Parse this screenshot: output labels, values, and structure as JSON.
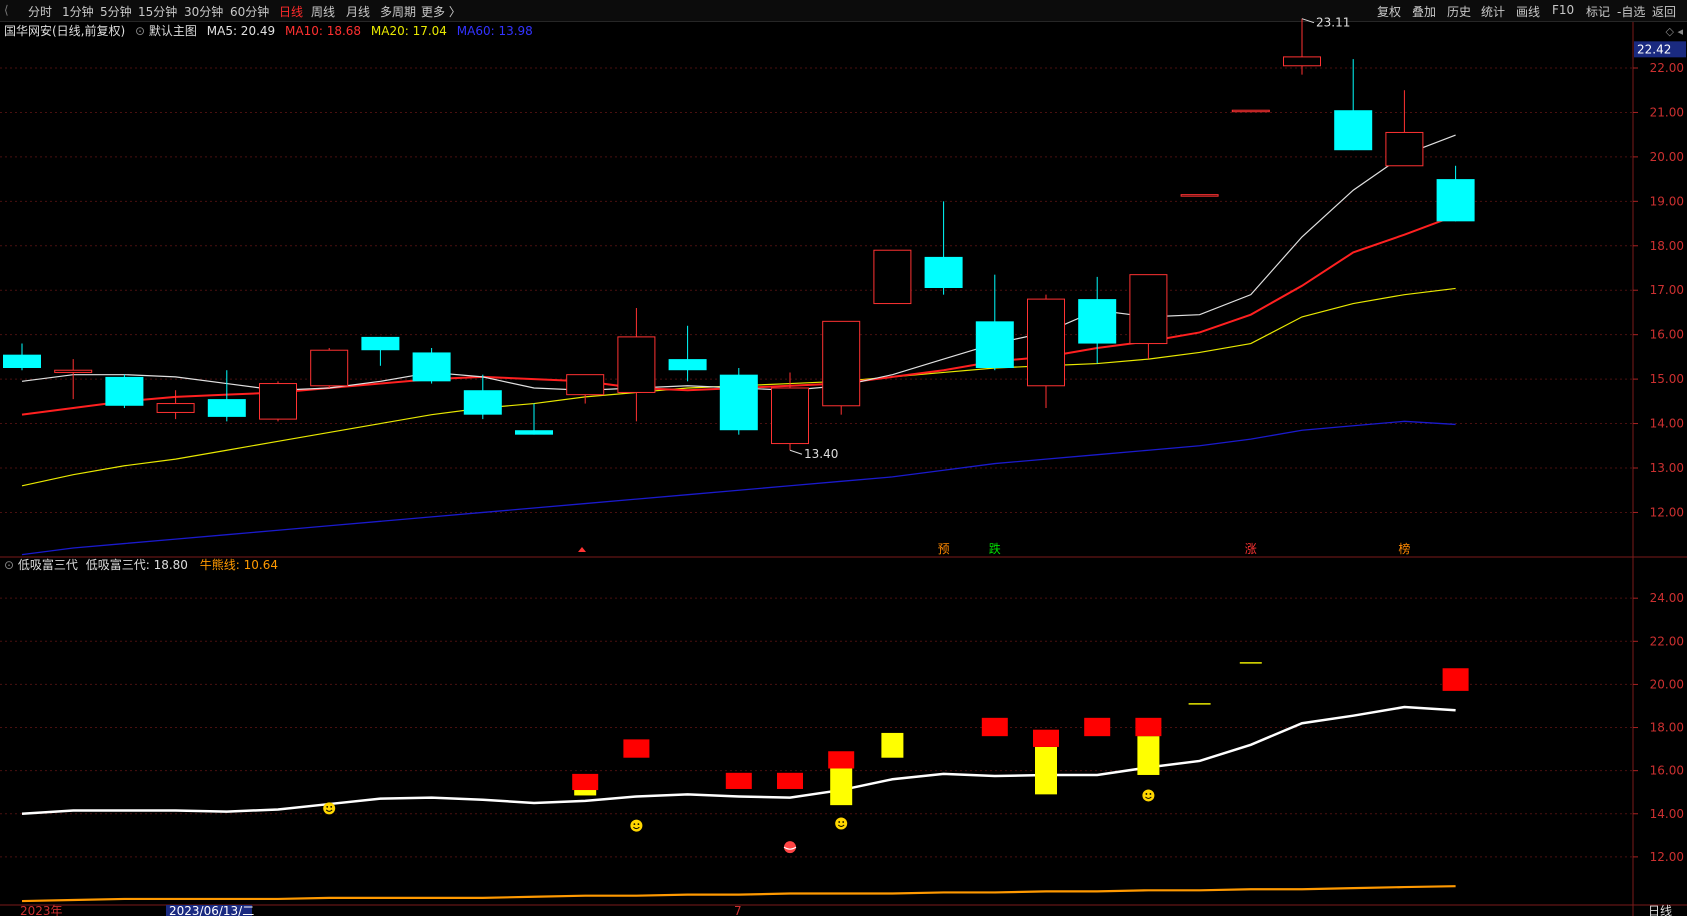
{
  "toolbar": {
    "periods": [
      {
        "label": "分时",
        "active": false
      },
      {
        "label": "1分钟",
        "active": false
      },
      {
        "label": "5分钟",
        "active": false
      },
      {
        "label": "15分钟",
        "active": false
      },
      {
        "label": "30分钟",
        "active": false
      },
      {
        "label": "60分钟",
        "active": false
      },
      {
        "label": "日线",
        "active": true
      },
      {
        "label": "周线",
        "active": false
      },
      {
        "label": "月线",
        "active": false
      },
      {
        "label": "多周期",
        "active": false
      },
      {
        "label": "更多 〉",
        "active": false
      }
    ],
    "right_items": [
      "复权",
      "叠加",
      "历史",
      "统计",
      "画线",
      "F10",
      "标记",
      "-自选",
      "返回"
    ]
  },
  "main_legend": {
    "stock": "国华网安(日线,前复权)",
    "template": "默认主图",
    "ma5": "MA5: 20.49",
    "ma10": "MA10: 18.68",
    "ma20": "MA20: 17.04",
    "ma60": "MA60: 13.98"
  },
  "sub_legend": {
    "name": "低吸富三代",
    "value1": "低吸富三代: 18.80",
    "value2": "牛熊线: 10.64"
  },
  "colors": {
    "up": "#ff3232",
    "down": "#00ffff",
    "ma5": "#e0e0e0",
    "ma10": "#ff2020",
    "ma20": "#e8e800",
    "ma60": "#1a1acc",
    "bullbear": "#ff9900",
    "sub_white": "#ffffff"
  },
  "chart_data": {
    "main": {
      "type": "candlestick",
      "ylim": [
        11.2,
        22.9
      ],
      "price_label": "22.42",
      "ticks": [
        12.0,
        13.0,
        14.0,
        15.0,
        16.0,
        17.0,
        18.0,
        19.0,
        20.0,
        21.0,
        22.0
      ],
      "candles": [
        {
          "o": 15.55,
          "c": 15.25,
          "h": 15.8,
          "l": 15.2
        },
        {
          "o": 15.15,
          "c": 15.2,
          "h": 15.45,
          "l": 14.55
        },
        {
          "o": 15.05,
          "c": 14.4,
          "h": 15.1,
          "l": 14.35
        },
        {
          "o": 14.25,
          "c": 14.45,
          "h": 14.75,
          "l": 14.1
        },
        {
          "o": 14.55,
          "c": 14.15,
          "h": 15.2,
          "l": 14.05
        },
        {
          "o": 14.1,
          "c": 14.9,
          "h": 14.95,
          "l": 14.05
        },
        {
          "o": 14.85,
          "c": 15.65,
          "h": 15.7,
          "l": 14.8
        },
        {
          "o": 15.95,
          "c": 15.65,
          "h": 15.95,
          "l": 15.3
        },
        {
          "o": 15.6,
          "c": 14.95,
          "h": 15.7,
          "l": 14.9
        },
        {
          "o": 14.75,
          "c": 14.2,
          "h": 15.1,
          "l": 14.1
        },
        {
          "o": 13.85,
          "c": 13.75,
          "h": 14.45,
          "l": 13.75
        },
        {
          "o": 14.65,
          "c": 15.1,
          "h": 15.1,
          "l": 14.45
        },
        {
          "o": 14.7,
          "c": 15.95,
          "h": 16.6,
          "l": 14.05
        },
        {
          "o": 15.45,
          "c": 15.2,
          "h": 16.2,
          "l": 14.95
        },
        {
          "o": 15.1,
          "c": 13.85,
          "h": 15.25,
          "l": 13.75
        },
        {
          "o": 13.55,
          "c": 14.8,
          "h": 15.15,
          "l": 13.4
        },
        {
          "o": 14.4,
          "c": 16.3,
          "h": 16.3,
          "l": 14.2
        },
        {
          "o": 16.7,
          "c": 17.9,
          "h": 17.9,
          "l": 16.7
        },
        {
          "o": 17.75,
          "c": 17.05,
          "h": 19.0,
          "l": 16.9
        },
        {
          "o": 16.3,
          "c": 15.25,
          "h": 17.35,
          "l": 15.2
        },
        {
          "o": 14.85,
          "c": 16.8,
          "h": 16.9,
          "l": 14.35
        },
        {
          "o": 16.8,
          "c": 15.8,
          "h": 17.3,
          "l": 15.35
        },
        {
          "o": 15.8,
          "c": 17.35,
          "h": 17.35,
          "l": 15.45
        },
        {
          "o": 19.15,
          "c": 19.15,
          "h": 19.15,
          "l": 19.15
        },
        {
          "o": 21.05,
          "c": 21.05,
          "h": 21.05,
          "l": 21.05
        },
        {
          "o": 22.05,
          "c": 22.25,
          "h": 23.11,
          "l": 21.85
        },
        {
          "o": 21.05,
          "c": 20.15,
          "h": 22.2,
          "l": 20.15
        },
        {
          "o": 19.8,
          "c": 20.55,
          "h": 21.5,
          "l": 19.8
        },
        {
          "o": 19.5,
          "c": 18.55,
          "h": 19.8,
          "l": 18.55
        }
      ],
      "ma5": [
        14.95,
        15.1,
        15.1,
        15.05,
        14.9,
        14.75,
        14.8,
        14.95,
        15.15,
        15.05,
        14.8,
        14.75,
        14.8,
        14.85,
        14.8,
        14.75,
        14.85,
        15.1,
        15.45,
        15.8,
        16.05,
        16.55,
        16.4,
        16.45,
        16.9,
        18.2,
        19.25,
        20.05,
        20.49
      ],
      "ma10": [
        14.2,
        14.35,
        14.5,
        14.6,
        14.65,
        14.7,
        14.8,
        14.9,
        15.0,
        15.05,
        15.0,
        14.95,
        14.8,
        14.75,
        14.8,
        14.85,
        14.9,
        15.05,
        15.2,
        15.4,
        15.5,
        15.7,
        15.85,
        16.05,
        16.45,
        17.1,
        17.85,
        18.25,
        18.68
      ],
      "ma20": [
        12.6,
        12.85,
        13.05,
        13.2,
        13.4,
        13.6,
        13.8,
        14.0,
        14.2,
        14.35,
        14.45,
        14.6,
        14.7,
        14.8,
        14.85,
        14.9,
        14.95,
        15.05,
        15.15,
        15.25,
        15.3,
        15.35,
        15.45,
        15.6,
        15.8,
        16.4,
        16.7,
        16.9,
        17.04
      ],
      "ma60": [
        11.05,
        11.2,
        11.3,
        11.4,
        11.5,
        11.6,
        11.7,
        11.8,
        11.9,
        12.0,
        12.1,
        12.2,
        12.3,
        12.4,
        12.5,
        12.6,
        12.7,
        12.8,
        12.95,
        13.1,
        13.2,
        13.3,
        13.4,
        13.5,
        13.65,
        13.85,
        13.95,
        14.05,
        13.98
      ],
      "annotations": [
        {
          "text": "23.11",
          "index": 25,
          "price": 23.11
        },
        {
          "text": "13.40",
          "index": 15,
          "price": 13.4
        }
      ],
      "signals": [
        {
          "text": "预",
          "index": 18,
          "color": "#ff8800"
        },
        {
          "text": "跌",
          "index": 19,
          "color": "#00dd00"
        },
        {
          "text": "涨",
          "index": 24,
          "color": "#ff3333"
        },
        {
          "text": "榜",
          "index": 27,
          "color": "#ff8800"
        }
      ]
    },
    "sub": {
      "type": "indicator",
      "ylim": [
        10.0,
        25.4
      ],
      "ticks": [
        12.0,
        14.0,
        16.0,
        18.0,
        20.0,
        22.0,
        24.0
      ],
      "white_line": [
        14.0,
        14.15,
        14.15,
        14.15,
        14.1,
        14.2,
        14.45,
        14.7,
        14.75,
        14.65,
        14.5,
        14.6,
        14.8,
        14.9,
        14.8,
        14.75,
        15.1,
        15.6,
        15.85,
        15.75,
        15.8,
        15.8,
        16.15,
        16.45,
        17.2,
        18.2,
        18.55,
        18.95,
        18.8
      ],
      "bullbear": [
        9.95,
        10.0,
        10.05,
        10.05,
        10.05,
        10.05,
        10.1,
        10.1,
        10.1,
        10.1,
        10.15,
        10.2,
        10.2,
        10.25,
        10.25,
        10.3,
        10.3,
        10.3,
        10.35,
        10.35,
        10.4,
        10.4,
        10.45,
        10.45,
        10.5,
        10.5,
        10.55,
        10.6,
        10.64
      ],
      "red_boxes": [
        {
          "index": 11,
          "top": 15.85,
          "bottom": 15.1
        },
        {
          "index": 12,
          "top": 17.45,
          "bottom": 16.6
        },
        {
          "index": 14,
          "top": 15.9,
          "bottom": 15.15
        },
        {
          "index": 15,
          "top": 15.9,
          "bottom": 15.15
        },
        {
          "index": 16,
          "top": 16.9,
          "bottom": 16.1
        },
        {
          "index": 19,
          "top": 18.45,
          "bottom": 17.6
        },
        {
          "index": 20,
          "top": 17.9,
          "bottom": 17.1
        },
        {
          "index": 21,
          "top": 18.45,
          "bottom": 17.6
        },
        {
          "index": 22,
          "top": 18.45,
          "bottom": 17.6
        },
        {
          "index": 28,
          "top": 20.75,
          "bottom": 19.7
        }
      ],
      "yellow_boxes": [
        {
          "index": 11,
          "top": 15.15,
          "bottom": 14.85
        },
        {
          "index": 16,
          "top": 16.2,
          "bottom": 14.4
        },
        {
          "index": 17,
          "top": 17.75,
          "bottom": 16.6
        },
        {
          "index": 20,
          "top": 17.1,
          "bottom": 14.9
        },
        {
          "index": 22,
          "top": 17.6,
          "bottom": 15.8
        },
        {
          "index": 23,
          "top": 19.1,
          "bottom": 19.1
        },
        {
          "index": 24,
          "top": 21.0,
          "bottom": 21.0
        }
      ],
      "smileys": [
        {
          "index": 6,
          "value": 14.25
        },
        {
          "index": 12,
          "value": 13.45
        },
        {
          "index": 16,
          "value": 13.55
        },
        {
          "index": 22,
          "value": 14.85
        }
      ],
      "ball": {
        "index": 15,
        "value": 12.45
      }
    },
    "bottom_axis": [
      "2023年",
      "2023/06/13/二",
      "7"
    ],
    "bottom_right": "日线"
  }
}
